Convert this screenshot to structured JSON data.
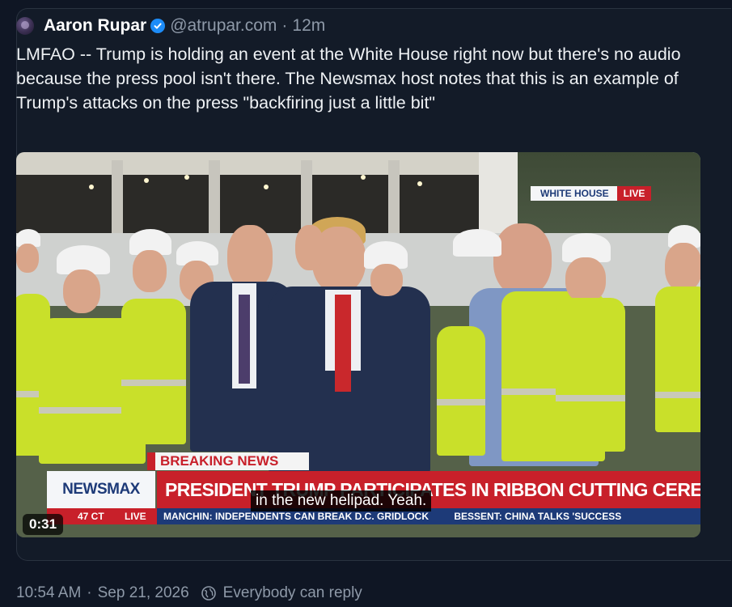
{
  "post": {
    "author_name": "Aaron Rupar",
    "handle": "@atrupar.com",
    "separator": "·",
    "age": "12m",
    "text": "LMFAO -- Trump is holding an event at the White House right now but there's no audio because the press pool isn't there. The Newsmax host notes that this is an example of Trump's attacks on the press \"backfiring just a little bit\""
  },
  "video": {
    "bug_location": "WHITE HOUSE",
    "bug_live": "LIVE",
    "breaking_label": "BREAKING NEWS",
    "network_logo": "NEWSMAX",
    "headline": "PRESIDENT TRUMP PARTICIPATES IN RIBBON CUTTING CEREMONY",
    "caption": "in the new helipad. Yeah.",
    "ticker_time": "47 CT",
    "ticker_live": "LIVE",
    "ticker_items": [
      "MANCHIN: INDEPENDENTS CAN BREAK D.C. GRIDLOCK",
      "BESSENT: CHINA TALKS 'SUCCESS"
    ],
    "playback_time": "0:31"
  },
  "footer": {
    "timestamp": "10:54 AM",
    "separator": "·",
    "date": "Sep 21, 2026",
    "reply_setting": "Everybody can reply"
  },
  "colors": {
    "background": "#0f1624",
    "verified_badge": "#1d8cf8",
    "newsmax_red": "#c8202a",
    "newsmax_blue": "#1d3a78",
    "muted_text": "#8e99a8"
  },
  "icons": {
    "avatar": "avatar-image",
    "verified": "verified-check-icon",
    "reply_setting": "globe-icon"
  }
}
